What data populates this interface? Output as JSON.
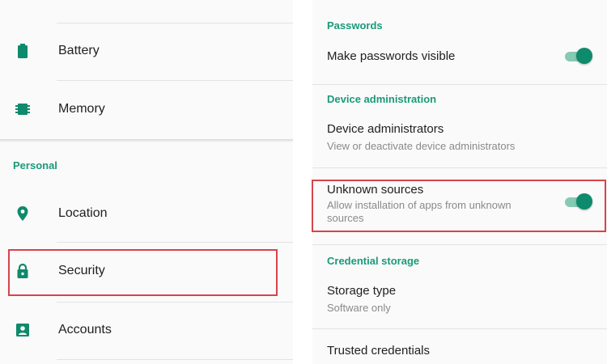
{
  "accent_color": "#1a9a7a",
  "highlight_color": "#d9434b",
  "left": {
    "items_top": [
      {
        "label": "Battery",
        "icon": "battery-icon"
      },
      {
        "label": "Memory",
        "icon": "memory-icon"
      }
    ],
    "category": "Personal",
    "items_personal": [
      {
        "label": "Location",
        "icon": "location-pin-icon"
      },
      {
        "label": "Security",
        "icon": "lock-icon",
        "highlighted": true
      },
      {
        "label": "Accounts",
        "icon": "account-icon"
      }
    ]
  },
  "right": {
    "passwords": {
      "category": "Passwords",
      "make_visible": {
        "title": "Make passwords visible",
        "enabled": true
      }
    },
    "device_admin": {
      "category": "Device administration",
      "administrators": {
        "title": "Device administrators",
        "subtitle": "View or deactivate device administrators"
      },
      "unknown_sources": {
        "title": "Unknown sources",
        "subtitle_line1": "Allow installation of apps from unknown",
        "subtitle_line2": "sources",
        "enabled": true,
        "highlighted": true
      }
    },
    "credential_storage": {
      "category": "Credential storage",
      "storage_type": {
        "title": "Storage type",
        "subtitle": "Software only"
      },
      "trusted_credentials": {
        "title": "Trusted credentials"
      }
    }
  }
}
